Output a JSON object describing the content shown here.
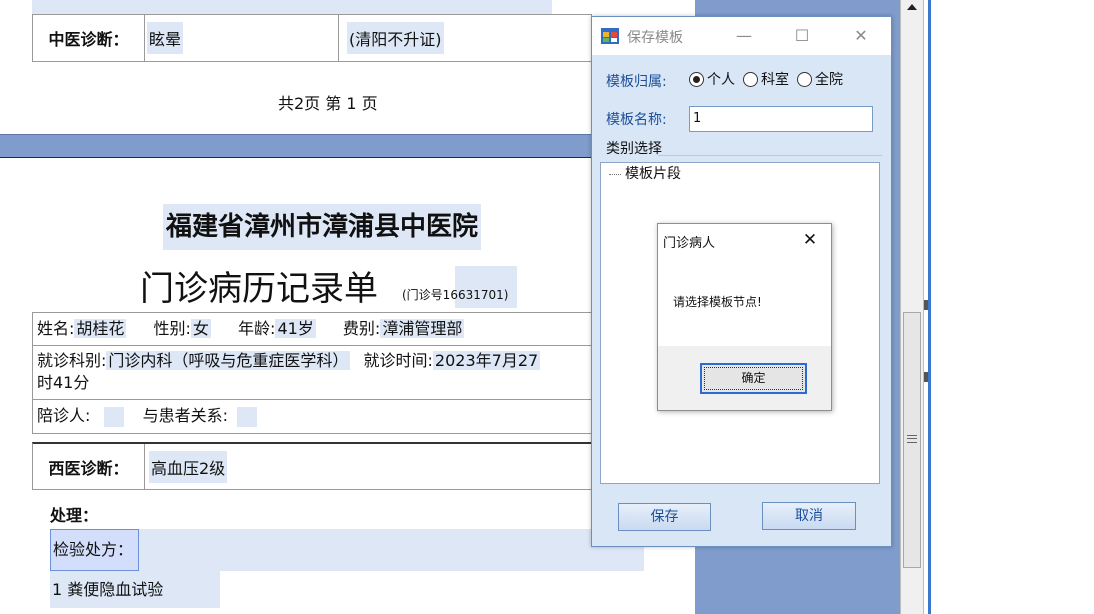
{
  "document": {
    "tcm_row": {
      "label": "中医诊断：",
      "value": "眩晕",
      "pattern": "(清阳不升证)"
    },
    "page_count": "共2页  第 1 页",
    "hospital_name": "福建省漳州市漳浦县中医院",
    "record_title": "门诊病历记录单",
    "record_number": "(门诊号16631701)",
    "patient": {
      "name_label": "姓名:",
      "name": "胡桂花",
      "gender_label": "性别:",
      "gender": "女",
      "age_label": "年龄:",
      "age": "41岁",
      "fee_label": "费别:",
      "fee": "漳浦管理部"
    },
    "visit": {
      "dept_label": "就诊科别:",
      "dept": "门诊内科（呼吸与危重症医学科）",
      "time_label": "就诊时间:",
      "time_part1": "2023年7月27",
      "time_part2": "时41分"
    },
    "companion": {
      "companion_label": "陪诊人:",
      "relation_label": "与患者关系:"
    },
    "wm_row": {
      "label": "西医诊断：",
      "value": "高血压2级"
    },
    "treatment_label": "处理：",
    "lab_label": "检验处方：",
    "lab_item_1": "1   粪便隐血试验"
  },
  "save_dialog": {
    "title": "保存模板",
    "minimize": "—",
    "maximize": "☐",
    "close": "✕",
    "ownership_label": "模板归属:",
    "ownership_options": [
      "个人",
      "科室",
      "全院"
    ],
    "ownership_selected": "个人",
    "name_label": "模板名称:",
    "name_value": "1",
    "category_label": "类别选择",
    "tree_root": "模板片段",
    "save_button": "保存",
    "cancel_button": "取消"
  },
  "message_box": {
    "title": "门诊病人",
    "close": "✕",
    "message": "请选择模板节点!",
    "ok_button": "确定"
  },
  "colors": {
    "highlight": "#dde7f6",
    "gutter": "#7f9ccc",
    "dialog_bg": "#d9e6f6",
    "dialog_label": "#1d4f99"
  }
}
